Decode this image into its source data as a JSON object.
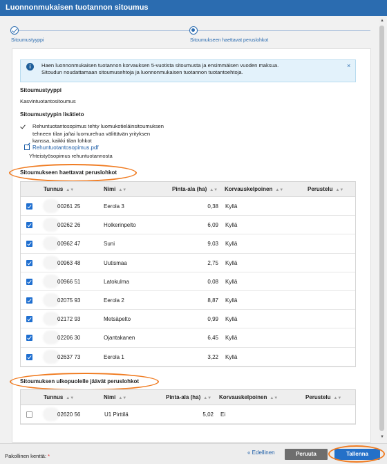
{
  "window": {
    "title": "Luonnonmukaisen tuotannon sitoumus"
  },
  "stepper": {
    "steps": [
      {
        "label": "Sitoumustyyppi",
        "state": "done"
      },
      {
        "label": "Sitoumukseen haettavat peruslohkot",
        "state": "active"
      }
    ]
  },
  "info": {
    "icon": "info-icon",
    "line1": "Haen luonnonmukaisen tuotannon korvauksen 5-vuotista sitoumusta ja ensimmäisen vuoden maksua.",
    "line2": "Sitoudun noudattamaan sitoumusehtoja ja luonnonmukaisen tuotannon tuotantoehtoja.",
    "close": "×"
  },
  "commitment": {
    "type_label": "Sitoumustyyppi",
    "type_value": "Kasvintuotantositoumus",
    "extra_label": "Sitoumustyypin lisätieto",
    "extra_line1": "Rehuntuotantosopimus tehty luomukotieläinsitoumuksen",
    "extra_line2": "tehneen tilan ja/tai luomurehua välittävän yrityksen",
    "extra_line3": "kanssa, kaikki tilan lohkot",
    "file_link": "Rehuntuotantosopimus.pdf",
    "file_desc": "Yhteistyösopimus rehuntuotannosta"
  },
  "included": {
    "section_title": "Sitoumukseen haettavat peruslohkot",
    "headers": {
      "tunnus": "Tunnus",
      "nimi": "Nimi",
      "pinta_ala": "Pinta-ala (ha)",
      "korvauskelpoinen": "Korvauskelpoinen",
      "perustelu": "Perustelu"
    },
    "rows": [
      {
        "checked": true,
        "tunnus": "00261 25",
        "nimi": "Eerola 3",
        "pinta_ala": "0,38",
        "korvauskelpoinen": "Kyllä",
        "perustelu": ""
      },
      {
        "checked": true,
        "tunnus": "00262 26",
        "nimi": "Holkerinpelto",
        "pinta_ala": "6,09",
        "korvauskelpoinen": "Kyllä",
        "perustelu": ""
      },
      {
        "checked": true,
        "tunnus": "00962 47",
        "nimi": "Suni",
        "pinta_ala": "9,03",
        "korvauskelpoinen": "Kyllä",
        "perustelu": ""
      },
      {
        "checked": true,
        "tunnus": "00963 48",
        "nimi": "Uutismaa",
        "pinta_ala": "2,75",
        "korvauskelpoinen": "Kyllä",
        "perustelu": ""
      },
      {
        "checked": true,
        "tunnus": "00966 51",
        "nimi": "Latokulma",
        "pinta_ala": "0,08",
        "korvauskelpoinen": "Kyllä",
        "perustelu": ""
      },
      {
        "checked": true,
        "tunnus": "02075 93",
        "nimi": "Eerola 2",
        "pinta_ala": "8,87",
        "korvauskelpoinen": "Kyllä",
        "perustelu": ""
      },
      {
        "checked": true,
        "tunnus": "02172 93",
        "nimi": "Metsäpelto",
        "pinta_ala": "0,99",
        "korvauskelpoinen": "Kyllä",
        "perustelu": ""
      },
      {
        "checked": true,
        "tunnus": "02206 30",
        "nimi": "Ojantakanen",
        "pinta_ala": "6,45",
        "korvauskelpoinen": "Kyllä",
        "perustelu": ""
      },
      {
        "checked": true,
        "tunnus": "02637 73",
        "nimi": "Eerola 1",
        "pinta_ala": "3,22",
        "korvauskelpoinen": "Kyllä",
        "perustelu": ""
      }
    ]
  },
  "excluded": {
    "section_title": "Sitoumuksen ulkopuolelle jäävät peruslohkot",
    "headers": {
      "tunnus": "Tunnus",
      "nimi": "Nimi",
      "pinta_ala": "Pinta-ala (ha)",
      "korvauskelpoinen": "Korvauskelpoinen",
      "perustelu": "Perustelu"
    },
    "rows": [
      {
        "checked": false,
        "tunnus": "02620 56",
        "nimi": "U1 Pirttilä",
        "pinta_ala": "5,02",
        "korvauskelpoinen": "Ei",
        "perustelu": ""
      }
    ]
  },
  "footer": {
    "required_label": "Pakollinen kenttä:",
    "required_star": "*",
    "previous": "« Edellinen",
    "cancel": "Peruuta",
    "save": "Tallenna"
  },
  "colors": {
    "titlebar": "#2b6cb0",
    "highlight": "#f07c22",
    "save_button": "#2470c8"
  }
}
